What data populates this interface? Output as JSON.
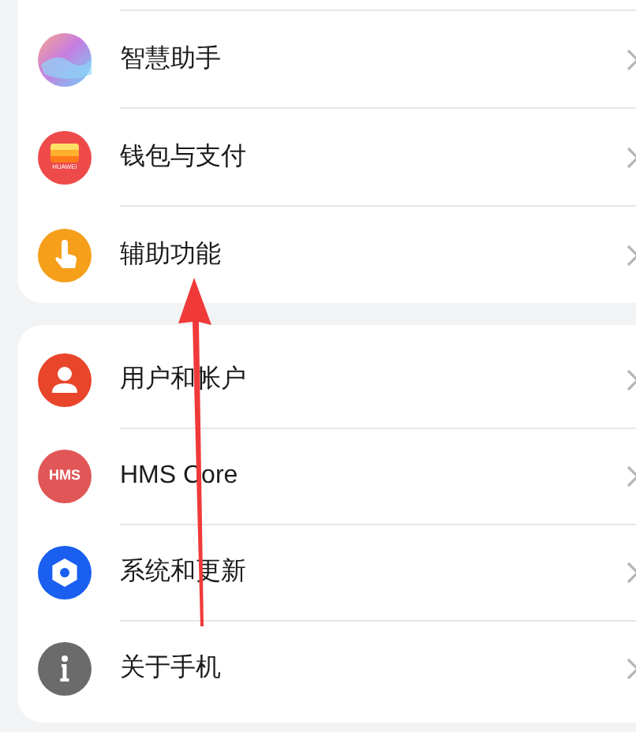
{
  "groups": [
    {
      "items": [
        {
          "label": "智慧助手",
          "kind": "assistant"
        },
        {
          "label": "钱包与支付",
          "kind": "wallet",
          "icon_text": "HUAWEI"
        },
        {
          "label": "辅助功能",
          "kind": "accessibility"
        }
      ]
    },
    {
      "items": [
        {
          "label": "用户和帐户",
          "kind": "user"
        },
        {
          "label": "HMS Core",
          "kind": "hms",
          "icon_text": "HMS"
        },
        {
          "label": "系统和更新",
          "kind": "system"
        },
        {
          "label": "关于手机",
          "kind": "about"
        }
      ]
    }
  ]
}
